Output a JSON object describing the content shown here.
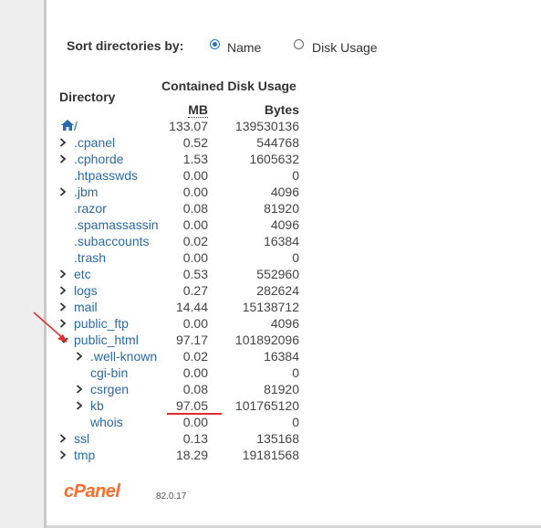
{
  "sort": {
    "label": "Sort directories by:",
    "options": [
      {
        "label": "Name",
        "selected": true
      },
      {
        "label": "Disk Usage",
        "selected": false
      }
    ]
  },
  "table": {
    "col_directory": "Directory",
    "col_contained": "Contained Disk Usage",
    "col_mb": "MB",
    "col_bytes": "Bytes",
    "root": {
      "name": "/",
      "mb": "133.07",
      "bytes": "139530136"
    },
    "rows": [
      {
        "name": ".cpanel",
        "mb": "0.52",
        "bytes": "544768",
        "expander": "collapsed",
        "depth": 0
      },
      {
        "name": ".cphorde",
        "mb": "1.53",
        "bytes": "1605632",
        "expander": "collapsed",
        "depth": 0
      },
      {
        "name": ".htpasswds",
        "mb": "0.00",
        "bytes": "0",
        "expander": "none",
        "depth": 0
      },
      {
        "name": ".jbm",
        "mb": "0.00",
        "bytes": "4096",
        "expander": "collapsed",
        "depth": 0
      },
      {
        "name": ".razor",
        "mb": "0.08",
        "bytes": "81920",
        "expander": "none",
        "depth": 0
      },
      {
        "name": ".spamassassin",
        "mb": "0.00",
        "bytes": "4096",
        "expander": "none",
        "depth": 0
      },
      {
        "name": ".subaccounts",
        "mb": "0.02",
        "bytes": "16384",
        "expander": "none",
        "depth": 0
      },
      {
        "name": ".trash",
        "mb": "0.00",
        "bytes": "0",
        "expander": "none",
        "depth": 0
      },
      {
        "name": "etc",
        "mb": "0.53",
        "bytes": "552960",
        "expander": "collapsed",
        "depth": 0
      },
      {
        "name": "logs",
        "mb": "0.27",
        "bytes": "282624",
        "expander": "collapsed",
        "depth": 0
      },
      {
        "name": "mail",
        "mb": "14.44",
        "bytes": "15138712",
        "expander": "collapsed",
        "depth": 0
      },
      {
        "name": "public_ftp",
        "mb": "0.00",
        "bytes": "4096",
        "expander": "collapsed",
        "depth": 0
      },
      {
        "name": "public_html",
        "mb": "97.17",
        "bytes": "101892096",
        "expander": "expanded",
        "depth": 0
      },
      {
        "name": ".well-known",
        "mb": "0.02",
        "bytes": "16384",
        "expander": "collapsed",
        "depth": 1
      },
      {
        "name": "cgi-bin",
        "mb": "0.00",
        "bytes": "0",
        "expander": "none",
        "depth": 1
      },
      {
        "name": "csrgen",
        "mb": "0.08",
        "bytes": "81920",
        "expander": "collapsed",
        "depth": 1
      },
      {
        "name": "kb",
        "mb": "97.05",
        "bytes": "101765120",
        "expander": "collapsed",
        "depth": 1
      },
      {
        "name": "whois",
        "mb": "0.00",
        "bytes": "0",
        "expander": "none",
        "depth": 1
      },
      {
        "name": "ssl",
        "mb": "0.13",
        "bytes": "135168",
        "expander": "collapsed",
        "depth": 0
      },
      {
        "name": "tmp",
        "mb": "18.29",
        "bytes": "19181568",
        "expander": "collapsed",
        "depth": 0
      }
    ]
  },
  "footer": {
    "logo": "cPanel",
    "version": "82.0.17"
  },
  "colors": {
    "link": "#2a6aa8",
    "accent": "#2572c7",
    "logo": "#ff6c2c",
    "annotation": "#e02d2d"
  },
  "icons": {
    "root": "home-icon",
    "collapsed": "chevron-right-icon",
    "expanded": "chevron-down-icon",
    "annotation_arrow": "arrow-annotation-icon"
  }
}
